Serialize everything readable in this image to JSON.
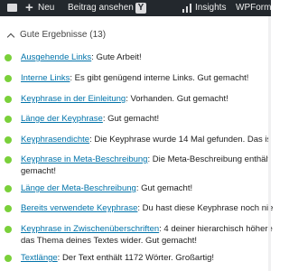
{
  "adminbar": {
    "new_label": "Neu",
    "view_label": "Beitrag ansehen",
    "yoast_letter": "Y",
    "insights_label": "Insights",
    "wpforms_label": "WPForms"
  },
  "section": {
    "title": "Gute Ergebnisse (13)"
  },
  "status_color": "#7ad03a",
  "link_color": "#0073aa",
  "results": [
    {
      "link": "Ausgehende Links",
      "text": ": Gute Arbeit!",
      "cont": ""
    },
    {
      "link": "Interne Links",
      "text": ": Es gibt genügend interne Links. Gut gemacht!",
      "cont": ""
    },
    {
      "link": "Keyphrase in der Einleitung",
      "text": ": Vorhanden. Gut gemacht!",
      "cont": ""
    },
    {
      "link": "Länge der Keyphrase",
      "text": ": Gut gemacht!",
      "cont": ""
    },
    {
      "link": "Keyphrasendichte",
      "text": ": Die Keyphrase wurde 14 Mal gefunden. Das is",
      "cont": ""
    },
    {
      "link": "Keyphrase in Meta-Beschreibung",
      "text": ": Die Meta-Beschreibung enthält",
      "cont": "gemacht!"
    },
    {
      "link": "Länge der Meta-Beschreibung",
      "text": ": Gut gemacht!",
      "cont": ""
    },
    {
      "link": "Bereits verwendete Keyphrase",
      "text": ": Du hast diese Keyphrase noch nie",
      "cont": ""
    },
    {
      "link": "Keyphrase in Zwischenüberschriften",
      "text": ": 4 deiner hierarchisch höhere",
      "cont": "das Thema deines Textes wider. Gut gemacht!"
    },
    {
      "link": "Textlänge",
      "text": ": Der Text enthält 1172 Wörter. Großartig!",
      "cont": ""
    }
  ]
}
